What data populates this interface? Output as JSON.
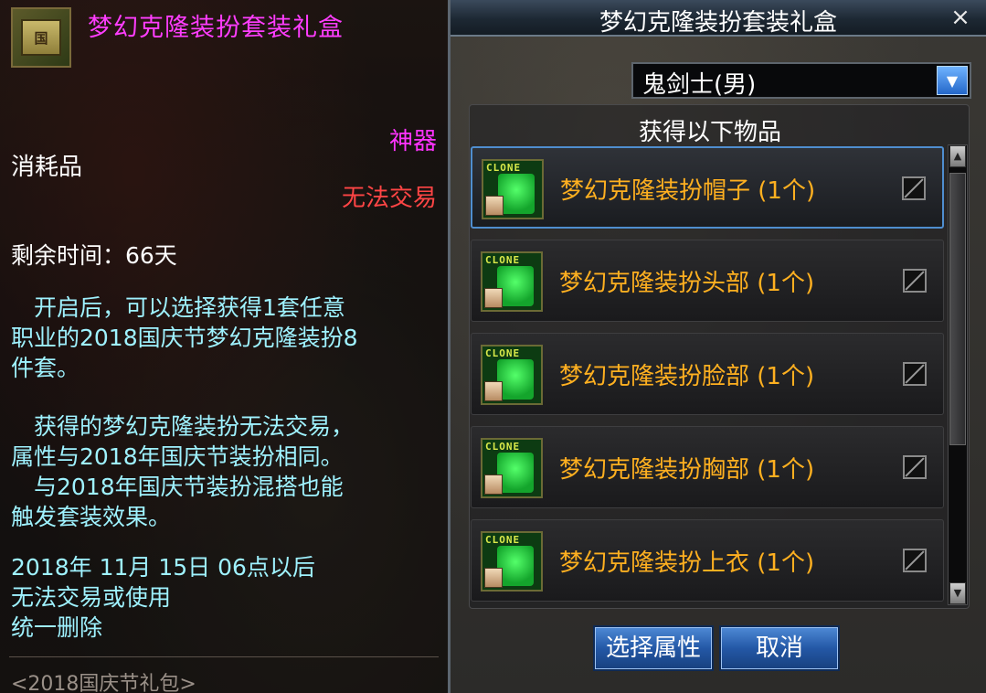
{
  "tooltip": {
    "icon_label": "国",
    "title": "梦幻克隆装扮套装礼盒",
    "rarity": "神器",
    "type": "消耗品",
    "trade": "无法交易",
    "remaining": "剩余时间：66天",
    "desc1": [
      "　开启后，可以选择获得1套任意",
      "职业的2018国庆节梦幻克隆装扮8",
      "件套。"
    ],
    "desc2": [
      "　获得的梦幻克隆装扮无法交易，",
      "属性与2018年国庆节装扮相同。",
      "　与2018年国庆节装扮混搭也能",
      "触发套装效果。"
    ],
    "desc3": [
      "2018年 11月 15日 06点以后",
      "无法交易或使用",
      "统一删除"
    ],
    "footer": "<2018国庆节礼包>"
  },
  "dialog": {
    "title": "梦幻克隆装扮套装礼盒",
    "close": "×",
    "class_select": "鬼剑士(男)",
    "list_header": "获得以下物品",
    "icon_text": "CLONE",
    "items": [
      {
        "name": "梦幻克隆装扮帽子 (1个)",
        "selected": true
      },
      {
        "name": "梦幻克隆装扮头部 (1个)",
        "selected": false
      },
      {
        "name": "梦幻克隆装扮脸部 (1个)",
        "selected": false
      },
      {
        "name": "梦幻克隆装扮胸部 (1个)",
        "selected": false
      },
      {
        "name": "梦幻克隆装扮上衣 (1个)",
        "selected": false
      }
    ],
    "btn_select": "选择属性",
    "btn_cancel": "取消"
  }
}
